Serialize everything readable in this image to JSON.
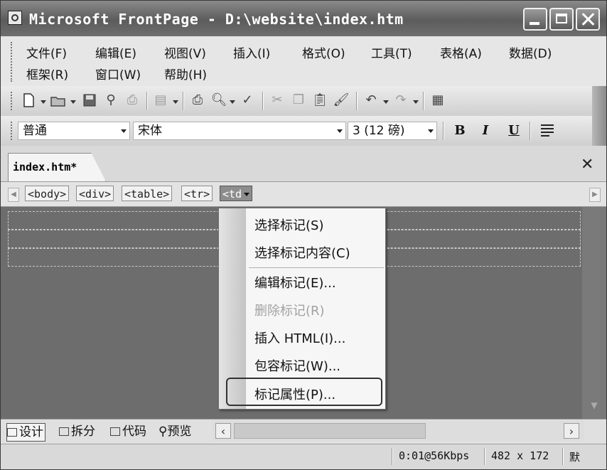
{
  "window": {
    "title": "Microsoft FrontPage - D:\\website\\index.htm"
  },
  "menubar": {
    "row1": [
      "文件(F)",
      "编辑(E)",
      "视图(V)",
      "插入(I)",
      "格式(O)",
      "工具(T)",
      "表格(A)",
      "数据(D)"
    ],
    "row2": [
      "框架(R)",
      "窗口(W)",
      "帮助(H)"
    ]
  },
  "toolbar": {
    "icons": [
      "new-page-icon",
      "open-folder-icon",
      "save-icon",
      "search-icon",
      "print-icon",
      "publish-icon",
      "print-preview-icon",
      "spell-check-icon",
      "cut-icon",
      "copy-icon",
      "paste-icon",
      "format-painter-icon",
      "undo-icon",
      "redo-icon",
      "insert-table-icon"
    ]
  },
  "formatting": {
    "style": "普通",
    "font": "宋体",
    "size": "3 (12 磅)",
    "bold": "B",
    "italic": "I",
    "underline": "U"
  },
  "tabs": {
    "document": "index.htm*"
  },
  "quick_tags": [
    "<body>",
    "<div>",
    "<table>",
    "<tr>",
    "<td"
  ],
  "context_menu": {
    "items": [
      {
        "label": "选择标记(S)",
        "enabled": true
      },
      {
        "label": "选择标记内容(C)",
        "enabled": true
      },
      {
        "label": "编辑标记(E)...",
        "enabled": true
      },
      {
        "label": "删除标记(R)",
        "enabled": false
      },
      {
        "label": "插入 HTML(I)...",
        "enabled": true
      },
      {
        "label": "包容标记(W)...",
        "enabled": true
      },
      {
        "label": "标记属性(P)...",
        "enabled": true
      }
    ]
  },
  "view_bar": {
    "design": "设计",
    "split": "拆分",
    "code": "代码",
    "preview": "预览"
  },
  "status": {
    "speed": "0:01@56Kbps",
    "dimensions": "482 x 172",
    "extra": "默"
  }
}
